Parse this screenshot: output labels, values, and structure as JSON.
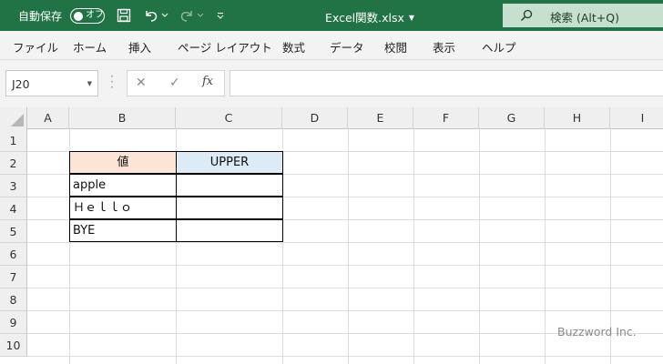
{
  "titlebar": {
    "autosave_label": "自動保存",
    "toggle_label": "オフ",
    "document_title": "Excel関数.xlsx",
    "search_text": "検索 (Alt+Q)"
  },
  "ribbon_tabs": [
    "ファイル",
    "ホーム",
    "挿入",
    "ページ レイアウト",
    "数式",
    "データ",
    "校閲",
    "表示",
    "ヘルプ"
  ],
  "formula_bar": {
    "name_box": "J20",
    "fx_label": "fx",
    "formula": ""
  },
  "columns": [
    "A",
    "B",
    "C",
    "D",
    "E",
    "F",
    "G",
    "H",
    "I"
  ],
  "rows": [
    "1",
    "2",
    "3",
    "4",
    "5",
    "6",
    "7",
    "8",
    "9",
    "10"
  ],
  "table": {
    "header_value": "値",
    "header_upper": "UPPER",
    "values": [
      "apple",
      "Ｈｅｌｌｏ",
      "BYE"
    ],
    "upper": [
      "",
      "",
      ""
    ]
  },
  "colors": {
    "titlebar": "#217346",
    "header_value_fill": "#fce4d6",
    "header_upper_fill": "#ddebf7"
  },
  "watermark": "Buzzword Inc."
}
